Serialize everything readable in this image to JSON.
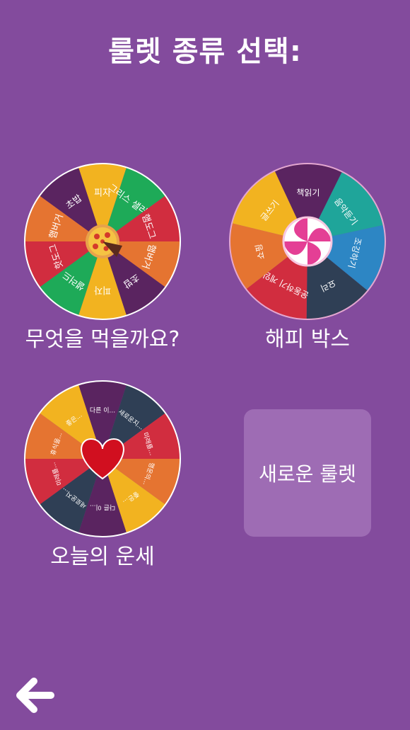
{
  "header": {
    "title": "룰렛 종류 선택:"
  },
  "wheels": {
    "food": {
      "label": "무엇을 먹을까요?",
      "segments": [
        {
          "text": "피자",
          "color": "#f2b320"
        },
        {
          "text": "그리스 샐러드",
          "color": "#1eaa58"
        },
        {
          "text": "햄도그",
          "color": "#d12d3f"
        },
        {
          "text": "햄버거",
          "color": "#e57431"
        },
        {
          "text": "초밥",
          "color": "#5a2460"
        },
        {
          "text": "피자",
          "color": "#f2b320"
        },
        {
          "text": "샐러드",
          "color": "#1eaa58"
        },
        {
          "text": "핫도그",
          "color": "#d12d3f"
        },
        {
          "text": "햄버거",
          "color": "#e57431"
        },
        {
          "text": "초밥",
          "color": "#5a2460"
        }
      ]
    },
    "happy": {
      "label": "해피 박스",
      "segments": [
        {
          "text": "책읽기",
          "color": "#5a2460"
        },
        {
          "text": "음악듣기",
          "color": "#1fa59a"
        },
        {
          "text": "조깅하기",
          "color": "#2d86c4"
        },
        {
          "text": "요리",
          "color": "#2f3f55"
        },
        {
          "text": "운동하기 게임",
          "color": "#d12d3f"
        },
        {
          "text": "쇼핑",
          "color": "#e57431"
        },
        {
          "text": "글쓰기",
          "color": "#f2b320"
        }
      ]
    },
    "fortune": {
      "label": "오늘의 운세",
      "segments": [
        {
          "text": "다른 이...",
          "color": "#5a2460"
        },
        {
          "text": "새로운지...",
          "color": "#2f3f55"
        },
        {
          "text": "미래를...",
          "color": "#d12d3f"
        },
        {
          "text": "행운의...",
          "color": "#e57431"
        },
        {
          "text": "좋은...",
          "color": "#f2b320"
        },
        {
          "text": "다른 이...",
          "color": "#5a2460"
        },
        {
          "text": "새로운지...",
          "color": "#2f3f55"
        },
        {
          "text": "미래를...",
          "color": "#d12d3f"
        },
        {
          "text": "휴식을...",
          "color": "#e57431"
        },
        {
          "text": "좋은...",
          "color": "#f2b320"
        }
      ]
    }
  },
  "new_wheel": {
    "label": "새로운 룰렛"
  },
  "icons": {
    "back": "back-arrow-icon",
    "pizza": "pizza-icon",
    "candy": "candy-icon",
    "heart": "heart-icon"
  }
}
